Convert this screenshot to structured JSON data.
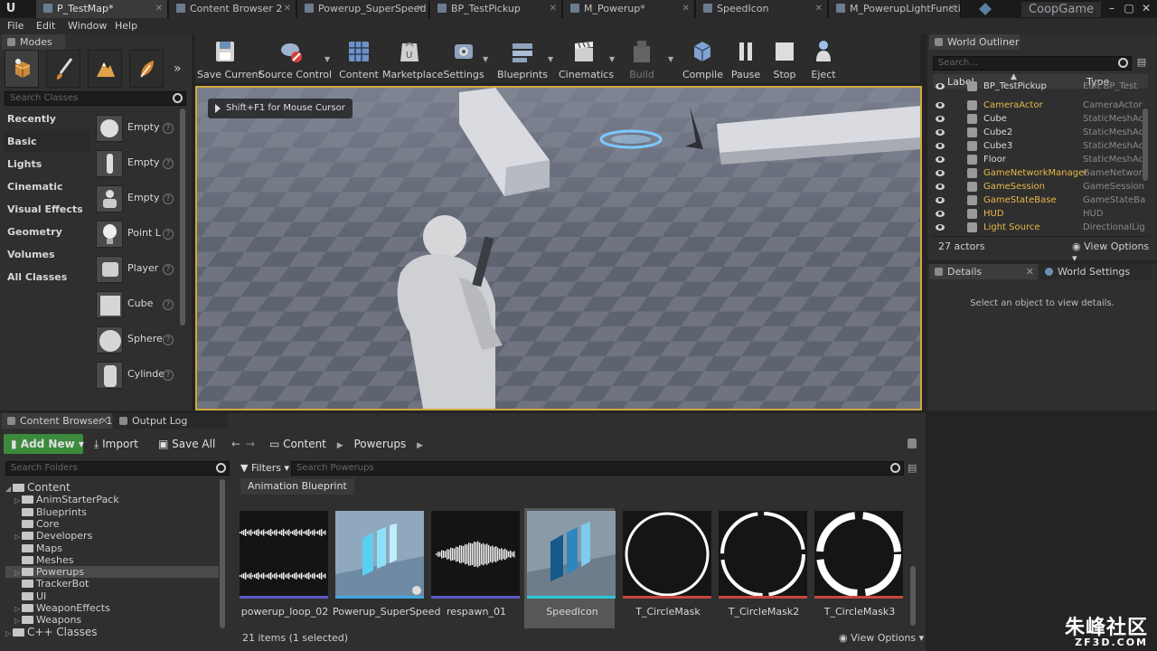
{
  "window": {
    "project": "CoopGame",
    "tabs": [
      "P_TestMap*",
      "Content Browser 2",
      "Powerup_SuperSpeed",
      "BP_TestPickup",
      "M_Powerup*",
      "SpeedIcon",
      "M_PowerupLightFuncti"
    ]
  },
  "menu": [
    "File",
    "Edit",
    "Window",
    "Help"
  ],
  "modes": {
    "tab": "Modes",
    "search_placeholder": "Search Classes",
    "categories": [
      "Recently Placed",
      "Basic",
      "Lights",
      "Cinematic",
      "Visual Effects",
      "Geometry",
      "Volumes",
      "All Classes"
    ],
    "active_category": "Basic",
    "items": [
      "Empty",
      "Empty",
      "Empty",
      "Point L",
      "Player",
      "Cube",
      "Sphere",
      "Cylinde"
    ]
  },
  "toolbar": {
    "buttons": [
      "Save Current",
      "Source Control",
      "Content",
      "Marketplace",
      "Settings",
      "Blueprints",
      "Cinematics",
      "Build",
      "Compile",
      "Pause",
      "Stop",
      "Eject"
    ]
  },
  "viewport": {
    "hint": "Shift+F1 for Mouse Cursor"
  },
  "outliner": {
    "tab": "World Outliner",
    "search_placeholder": "Search...",
    "col_label": "Label",
    "col_type": "Type",
    "rows": [
      {
        "label": "BP_TestPickup",
        "type": "Edit BP_Test",
        "link": false
      },
      {
        "label": "CameraActor",
        "type": "CameraActor",
        "link": true
      },
      {
        "label": "Cube",
        "type": "StaticMeshAc",
        "link": false
      },
      {
        "label": "Cube2",
        "type": "StaticMeshAc",
        "link": false
      },
      {
        "label": "Cube3",
        "type": "StaticMeshAc",
        "link": false
      },
      {
        "label": "Floor",
        "type": "StaticMeshAc",
        "link": false
      },
      {
        "label": "GameNetworkManager",
        "type": "GameNetwork",
        "link": true
      },
      {
        "label": "GameSession",
        "type": "GameSession",
        "link": true
      },
      {
        "label": "GameStateBase",
        "type": "GameStateBa",
        "link": true
      },
      {
        "label": "HUD",
        "type": "HUD",
        "link": true
      },
      {
        "label": "Light Source",
        "type": "DirectionalLig",
        "link": true
      }
    ],
    "count": "27 actors",
    "view_options": "View Options"
  },
  "details": {
    "tab": "Details",
    "tab2": "World Settings",
    "empty_text": "Select an object to view details."
  },
  "content_browser": {
    "tab": "Content Browser 1",
    "tab2": "Output Log",
    "add_new": "Add New",
    "import": "Import",
    "save_all": "Save All",
    "breadcrumb": [
      "Content",
      "Powerups"
    ],
    "search_folders": "Search Folders",
    "filters": "Filters",
    "search_placeholder": "Search Powerups",
    "filter_chip": "Animation Blueprint",
    "tree": [
      {
        "name": "Content",
        "level": 0,
        "arrow": "down"
      },
      {
        "name": "AnimStarterPack",
        "level": 1,
        "arrow": "right"
      },
      {
        "name": "Blueprints",
        "level": 1,
        "arrow": ""
      },
      {
        "name": "Core",
        "level": 1,
        "arrow": ""
      },
      {
        "name": "Developers",
        "level": 1,
        "arrow": "right"
      },
      {
        "name": "Maps",
        "level": 1,
        "arrow": ""
      },
      {
        "name": "Meshes",
        "level": 1,
        "arrow": ""
      },
      {
        "name": "Powerups",
        "level": 1,
        "arrow": "right"
      },
      {
        "name": "TrackerBot",
        "level": 1,
        "arrow": ""
      },
      {
        "name": "UI",
        "level": 1,
        "arrow": ""
      },
      {
        "name": "WeaponEffects",
        "level": 1,
        "arrow": "right"
      },
      {
        "name": "Weapons",
        "level": 1,
        "arrow": "right"
      },
      {
        "name": "C++ Classes",
        "level": 0,
        "arrow": "right"
      }
    ],
    "selected_folder": "Powerups",
    "assets": [
      {
        "name": "powerup_loop_02",
        "kind": "wave",
        "bar": "#5a5ac8"
      },
      {
        "name": "Powerup_SuperSpeed",
        "kind": "speed-light",
        "bar": "#3fa7e0"
      },
      {
        "name": "respawn_01",
        "kind": "wave2",
        "bar": "#5a5ac8"
      },
      {
        "name": "SpeedIcon",
        "kind": "speed-dark",
        "bar": "#2ec8d8"
      },
      {
        "name": "T_CircleMask",
        "kind": "circle",
        "bar": "#c8473a"
      },
      {
        "name": "T_CircleMask2",
        "kind": "circle-gap",
        "bar": "#c8473a"
      },
      {
        "name": "T_CircleMask3",
        "kind": "circle-thick",
        "bar": "#c8473a"
      }
    ],
    "selected_asset": "SpeedIcon",
    "status": "21 items (1 selected)",
    "view_options": "View Options"
  },
  "watermark": {
    "main": "朱峰社区",
    "sub": "ZF3D.COM"
  }
}
